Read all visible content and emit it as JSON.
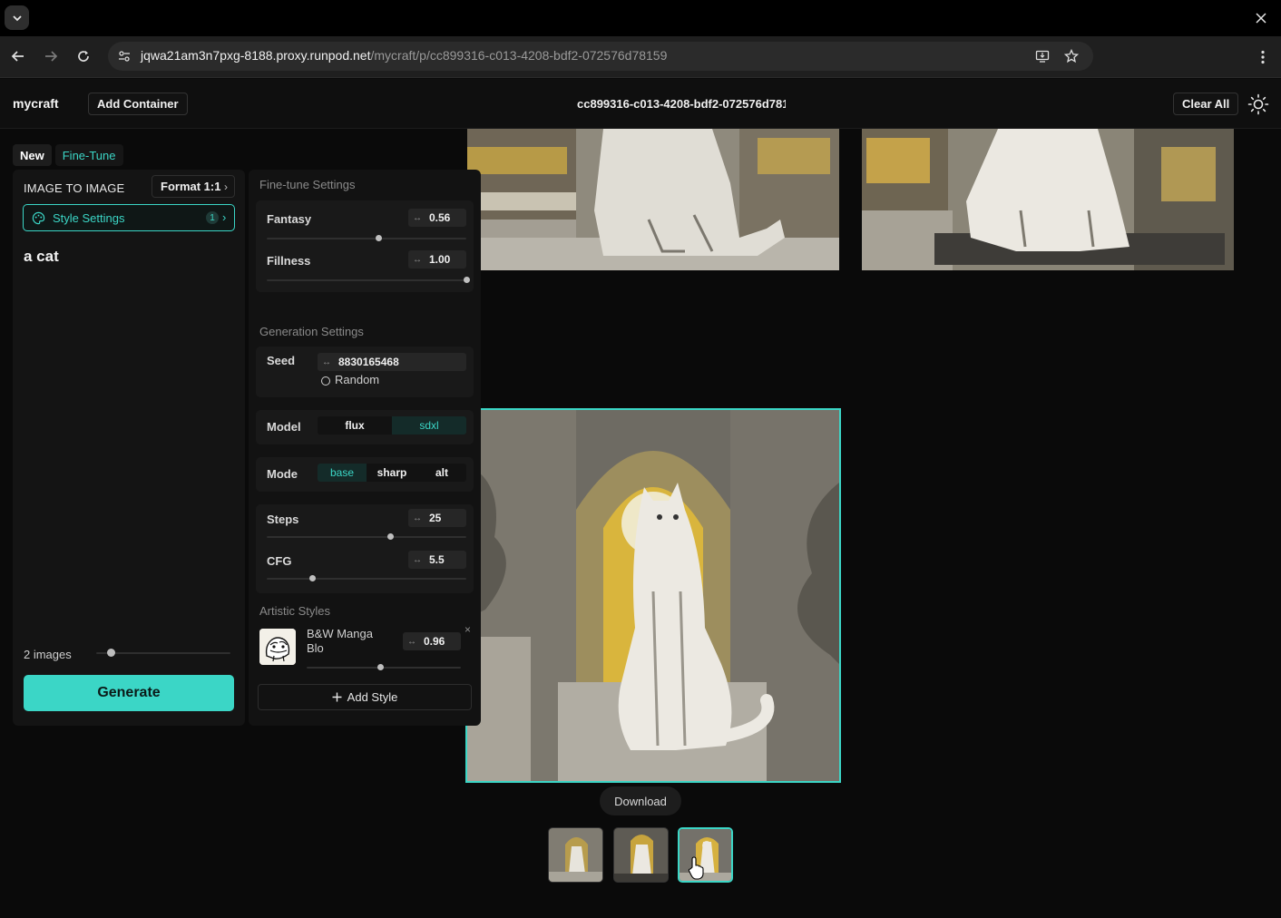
{
  "browser": {
    "url_host": "jqwa21am3n7pxg-8188.proxy.runpod.net",
    "url_path": "/mycraft/p/cc899316-c013-4208-bdf2-072576d78159"
  },
  "header": {
    "brand": "mycraft",
    "add_container": "Add Container",
    "container_id": "cc899316-c013-4208-bdf2-072576d78159",
    "clear_all": "Clear All"
  },
  "tabs": {
    "new": "New",
    "fine_tune": "Fine-Tune"
  },
  "left": {
    "mode": "IMAGE TO IMAGE",
    "format": "Format 1:1",
    "style_settings": "Style Settings",
    "style_count": "1",
    "prompt": "a cat",
    "images_label": "2 images",
    "images_value": 2,
    "generate": "Generate"
  },
  "fine_tune": {
    "title": "Fine-tune Settings",
    "fantasy": {
      "label": "Fantasy",
      "value": "0.56",
      "fraction": 0.56
    },
    "fillness": {
      "label": "Fillness",
      "value": "1.00",
      "fraction": 1.0
    }
  },
  "generation": {
    "title": "Generation Settings",
    "seed_label": "Seed",
    "seed_value": "8830165468",
    "random_label": "Random",
    "model_label": "Model",
    "model_options": [
      "flux",
      "sdxl"
    ],
    "model_selected": "sdxl",
    "mode_label": "Mode",
    "mode_options": [
      "base",
      "sharp",
      "alt"
    ],
    "mode_selected": "base",
    "steps": {
      "label": "Steps",
      "value": "25",
      "fraction": 0.62
    },
    "cfg": {
      "label": "CFG",
      "value": "5.5",
      "fraction": 0.23
    }
  },
  "artistic": {
    "title": "Artistic Styles",
    "style_name": "B&W Manga Blo",
    "style_value": "0.96",
    "style_fraction": 0.48,
    "remove": "×",
    "add_style": "Add Style"
  },
  "gallery": {
    "download": "Download",
    "thumbnail_count": 3,
    "selected_index": 2
  },
  "colors": {
    "accent": "#3bd6c6",
    "bg": "#0a0a0a",
    "panel": "#141414"
  }
}
